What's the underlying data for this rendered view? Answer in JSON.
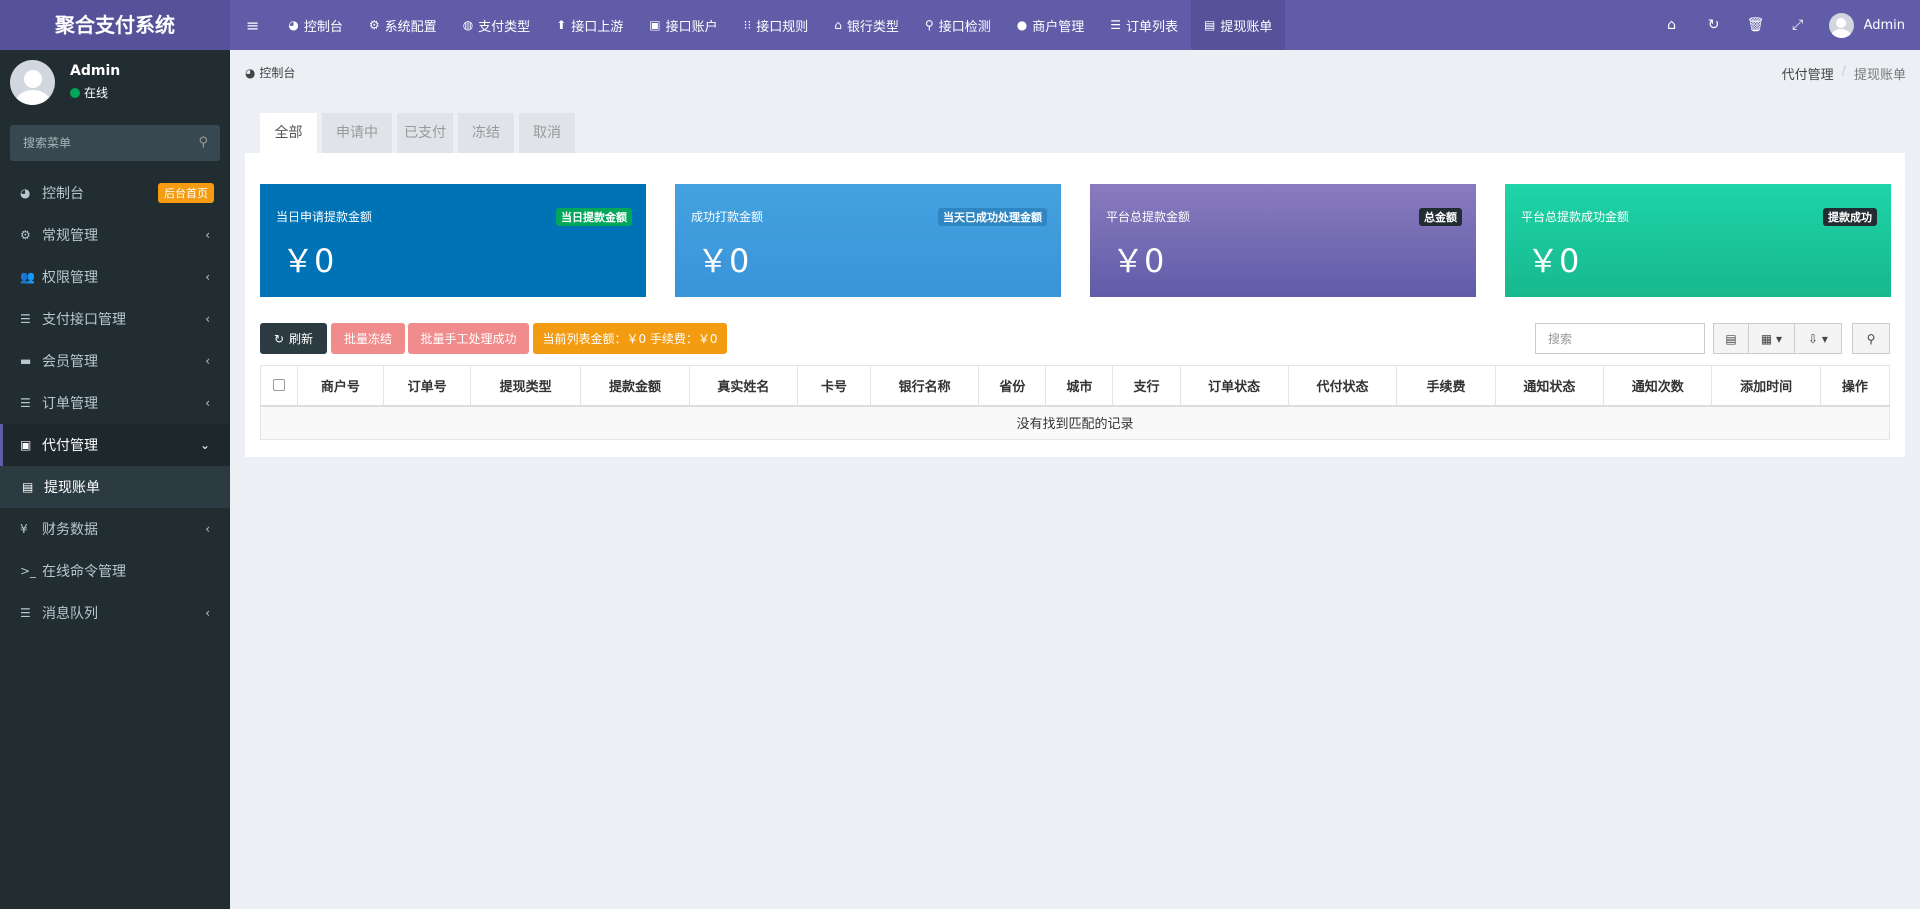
{
  "app": {
    "logo": "聚合支付系统"
  },
  "topnav": {
    "items": [
      {
        "icon": "dashboard-icon",
        "glyph": "◕",
        "label": "控制台"
      },
      {
        "icon": "gear-icon",
        "glyph": "⚙",
        "label": "系统配置"
      },
      {
        "icon": "globe-icon",
        "glyph": "◍",
        "label": "支付类型"
      },
      {
        "icon": "arrow-up-icon",
        "glyph": "⬆",
        "label": "接口上游"
      },
      {
        "icon": "account-icon",
        "glyph": "▣",
        "label": "接口账户"
      },
      {
        "icon": "rules-icon",
        "glyph": "⁝⁝",
        "label": "接口规则"
      },
      {
        "icon": "bank-icon",
        "glyph": "⌂",
        "label": "银行类型"
      },
      {
        "icon": "search-icon",
        "glyph": "⚲",
        "label": "接口检测"
      },
      {
        "icon": "user-icon",
        "glyph": "●",
        "label": "商户管理"
      },
      {
        "icon": "list-icon",
        "glyph": "☰",
        "label": "订单列表"
      },
      {
        "icon": "id-card-icon",
        "glyph": "▤",
        "label": "提现账单"
      }
    ],
    "right": {
      "username": "Admin"
    }
  },
  "sidebar": {
    "user": {
      "name": "Admin",
      "status": "在线"
    },
    "search_placeholder": "搜索菜单",
    "items": [
      {
        "name": "sidebar-item-dashboard",
        "icon": "dashboard-icon",
        "glyph": "◕",
        "label": "控制台",
        "badge": "后台首页"
      },
      {
        "name": "sidebar-item-general",
        "icon": "cogs-icon",
        "glyph": "⚙",
        "label": "常规管理",
        "arrow": "‹"
      },
      {
        "name": "sidebar-item-permissions",
        "icon": "users-icon",
        "glyph": "👥",
        "label": "权限管理",
        "arrow": "‹"
      },
      {
        "name": "sidebar-item-payment-interface",
        "icon": "list-icon",
        "glyph": "☰",
        "label": "支付接口管理",
        "arrow": "‹"
      },
      {
        "name": "sidebar-item-members",
        "icon": "member-icon",
        "glyph": "▬",
        "label": "会员管理",
        "arrow": "‹"
      },
      {
        "name": "sidebar-item-orders",
        "icon": "list-icon",
        "glyph": "☰",
        "label": "订单管理",
        "arrow": "‹"
      },
      {
        "name": "sidebar-item-payout",
        "icon": "money-icon",
        "glyph": "▣",
        "label": "代付管理",
        "arrow": "⌄",
        "open": true
      },
      {
        "name": "sidebar-item-withdraw-bill",
        "icon": "id-card-icon",
        "glyph": "▤",
        "label": "提现账单",
        "sub": true
      },
      {
        "name": "sidebar-item-finance",
        "icon": "yen-icon",
        "glyph": "¥",
        "label": "财务数据",
        "arrow": "‹"
      },
      {
        "name": "sidebar-item-console",
        "icon": "terminal-icon",
        "glyph": ">_",
        "label": "在线命令管理"
      },
      {
        "name": "sidebar-item-queue",
        "icon": "list-icon",
        "glyph": "☰",
        "label": "消息队列",
        "arrow": "‹"
      }
    ]
  },
  "header": {
    "title": "控制台"
  },
  "breadcrumb": {
    "parent": "代付管理",
    "sep": "/",
    "current": "提现账单"
  },
  "tabs": [
    "全部",
    "申请中",
    "已支付",
    "冻结",
    "取消"
  ],
  "stats": [
    {
      "label": "当日申请提款金额",
      "tag": "当日提款金额",
      "value": "￥0",
      "bg": "#0073b7",
      "tag_bg": "#00a65a"
    },
    {
      "label": "成功打款金额",
      "tag": "当天已成功处理金额",
      "value": "￥0",
      "bg": "#3c8dbc",
      "tag_bg": "#3c8dbc"
    },
    {
      "label": "平台总提款金额",
      "tag": "总金额",
      "value": "￥0",
      "bg": "#605ca8",
      "tag_bg": "#222d32"
    },
    {
      "label": "平台总提款成功金额",
      "tag": "提款成功",
      "value": "￥0",
      "bg": "#1bc098",
      "tag_bg": "#222d32"
    }
  ],
  "toolbar": {
    "refresh": "刷新",
    "batch_freeze": "批量冻结",
    "batch_manual": "批量手工处理成功",
    "summary": "当前列表金额：￥0  手续费：￥0",
    "search_placeholder": "搜索"
  },
  "table": {
    "columns": [
      "商户号",
      "订单号",
      "提现类型",
      "提款金额",
      "真实姓名",
      "卡号",
      "银行名称",
      "省份",
      "城市",
      "支行",
      "订单状态",
      "代付状态",
      "手续费",
      "通知状态",
      "通知次数",
      "添加时间",
      "操作"
    ],
    "empty_text": "没有找到匹配的记录"
  }
}
